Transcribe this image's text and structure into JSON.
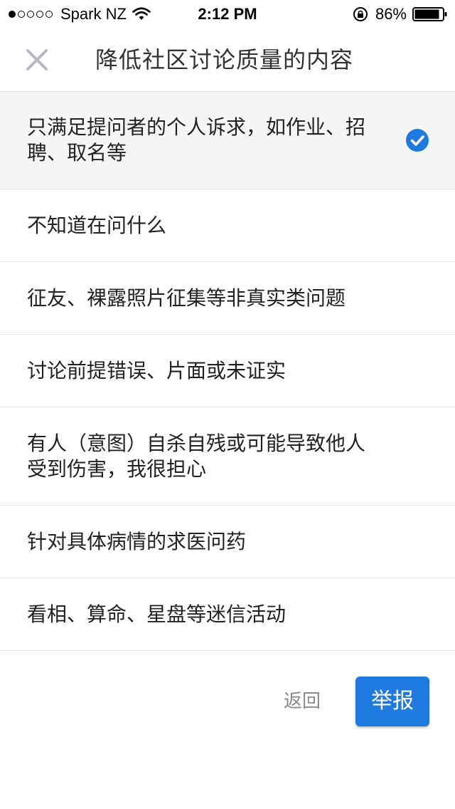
{
  "status_bar": {
    "carrier": "Spark NZ",
    "time": "2:12 PM",
    "battery": "86%",
    "signal_bars_filled": 1,
    "signal_bars_total": 5
  },
  "nav": {
    "title": "降低社区讨论质量的内容"
  },
  "options": [
    {
      "label": "只满足提问者的个人诉求，如作业、招聘、取名等",
      "selected": true
    },
    {
      "label": "不知道在问什么",
      "selected": false
    },
    {
      "label": "征友、裸露照片征集等非真实类问题",
      "selected": false
    },
    {
      "label": "讨论前提错误、片面或未证实",
      "selected": false
    },
    {
      "label": "有人（意图）自杀自残或可能导致他人受到伤害，我很担心",
      "selected": false
    },
    {
      "label": "针对具体病情的求医问药",
      "selected": false
    },
    {
      "label": "看相、算命、星盘等迷信活动",
      "selected": false
    }
  ],
  "footer": {
    "back_label": "返回",
    "report_label": "举报"
  },
  "colors": {
    "accent": "#1f7ae0",
    "selected_bg": "#f5f5f5"
  }
}
